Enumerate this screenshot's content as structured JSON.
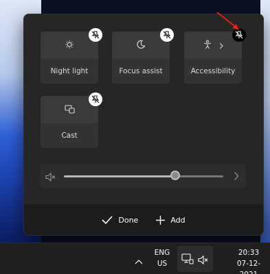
{
  "quick_settings": {
    "tiles": [
      {
        "label": "Night light",
        "icon": "night-light-icon",
        "has_unpin": true
      },
      {
        "label": "Focus assist",
        "icon": "focus-assist-icon",
        "has_unpin": true
      },
      {
        "label": "Accessibility",
        "icon": "accessibility-icon",
        "has_chevron": true,
        "has_unpin": true
      },
      {
        "label": "Cast",
        "icon": "cast-icon",
        "has_unpin": true
      }
    ],
    "volume": {
      "level_fraction": 0.7,
      "muted": true,
      "icon": "speaker-muted-icon",
      "next_icon": "chevron-right-icon"
    },
    "footer": {
      "done_label": "Done",
      "add_label": "Add"
    }
  },
  "annotation": {
    "arrow_color": "#e0231c",
    "points_to": "unpin-accessibility-icon"
  },
  "taskbar": {
    "language_line1": "ENG",
    "language_line2": "US",
    "time": "20:33",
    "date": "07-12-2021",
    "icons": [
      "chevron-up-icon",
      "network-icon",
      "speaker-muted-icon"
    ]
  },
  "colors": {
    "panel_bg": "#1f1f1f",
    "tile_bg": "#3a3a3a",
    "text": "#ffffff"
  }
}
